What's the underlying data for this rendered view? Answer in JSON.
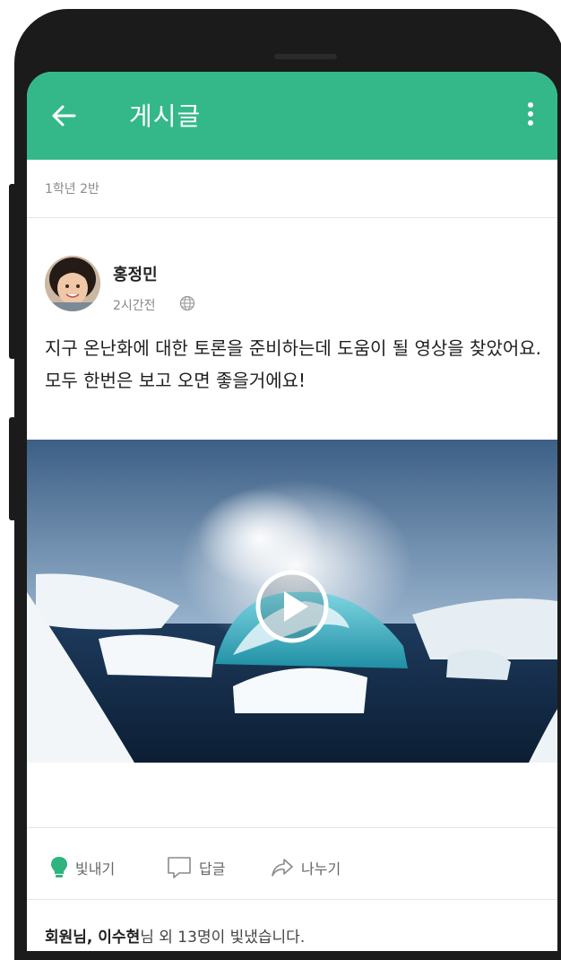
{
  "header": {
    "title": "게시글"
  },
  "group": {
    "label": "1학년 2반"
  },
  "post": {
    "author": "홍정민",
    "time": "2시간전",
    "body": "지구 온난화에 대한 토론을 준비하는데 도움이 될 영상을 찾았어요. 모두 한번은 보고 오면 좋을거에요!"
  },
  "actions": {
    "like": "빛내기",
    "reply": "답글",
    "share": "나누기"
  },
  "likes": {
    "prefix": "회원님, ",
    "name": "이수현",
    "suffix": "님 외 13명이 빛냈습니다."
  },
  "colors": {
    "accent": "#34b889"
  },
  "icons": [
    "back-arrow-icon",
    "more-vertical-icon",
    "globe-icon",
    "play-icon",
    "lightbulb-icon",
    "comment-icon",
    "share-icon"
  ]
}
